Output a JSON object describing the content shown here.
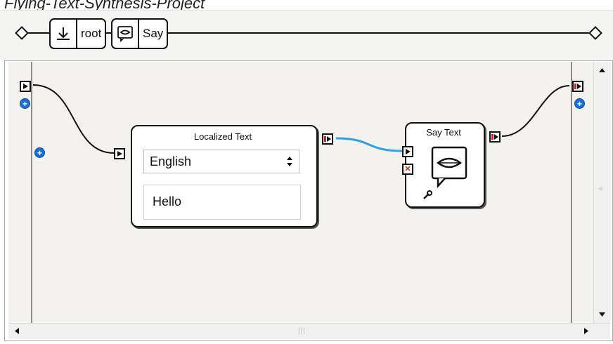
{
  "caption": "Flying-Text-Synthesis-Project",
  "breadcrumb": {
    "items": [
      {
        "label": "root",
        "icon": "root-behavior-icon"
      },
      {
        "label": "Say",
        "icon": "speech-bubble-icon"
      }
    ]
  },
  "boxes": {
    "localized_text": {
      "title": "Localized Text",
      "language": "English",
      "language_icon": "updown-arrows-icon",
      "text": "Hello"
    },
    "say_text": {
      "title": "Say Text",
      "icon": "speech-bubble-icon",
      "params_icon": "wrench-icon"
    }
  },
  "colors": {
    "canvas": "#f3f2ee",
    "wire": "#111111",
    "wire_selected": "#2aa0ea",
    "add_button": "#1a6fd6",
    "stop_input": "#d41f1f"
  }
}
